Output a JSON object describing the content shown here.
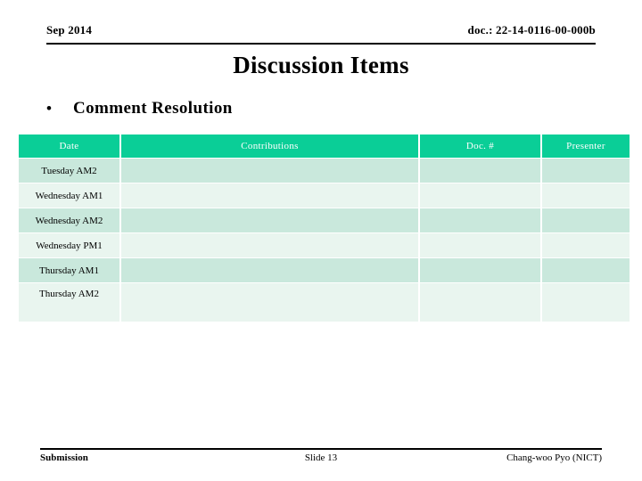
{
  "header": {
    "date": "Sep 2014",
    "doc_ref": "doc.: 22-14-0116-00-000b"
  },
  "title": "Discussion Items",
  "bullets": [
    {
      "marker": "•",
      "text": "Comment Resolution"
    }
  ],
  "table": {
    "columns": [
      {
        "key": "date",
        "label": "Date"
      },
      {
        "key": "contributions",
        "label": "Contributions"
      },
      {
        "key": "doc",
        "label": "Doc. #"
      },
      {
        "key": "presenter",
        "label": "Presenter"
      }
    ],
    "rows": [
      {
        "date": "Tuesday AM2",
        "contributions": "",
        "doc": "",
        "presenter": ""
      },
      {
        "date": "Wednesday AM1",
        "contributions": "",
        "doc": "",
        "presenter": ""
      },
      {
        "date": "Wednesday AM2",
        "contributions": "",
        "doc": "",
        "presenter": ""
      },
      {
        "date": "Wednesday PM1",
        "contributions": "",
        "doc": "",
        "presenter": ""
      },
      {
        "date": "Thursday AM1",
        "contributions": "",
        "doc": "",
        "presenter": ""
      },
      {
        "date": "Thursday AM2",
        "contributions": "",
        "doc": "",
        "presenter": ""
      }
    ]
  },
  "footer": {
    "left": "Submission",
    "center": "Slide 13",
    "right": "Chang-woo Pyo (NICT)"
  },
  "colors": {
    "header_row": "#0ACE97",
    "row_dark": "#c9e8dc",
    "row_light": "#e9f5ef",
    "text": "#000000",
    "header_text": "#ffffff"
  }
}
